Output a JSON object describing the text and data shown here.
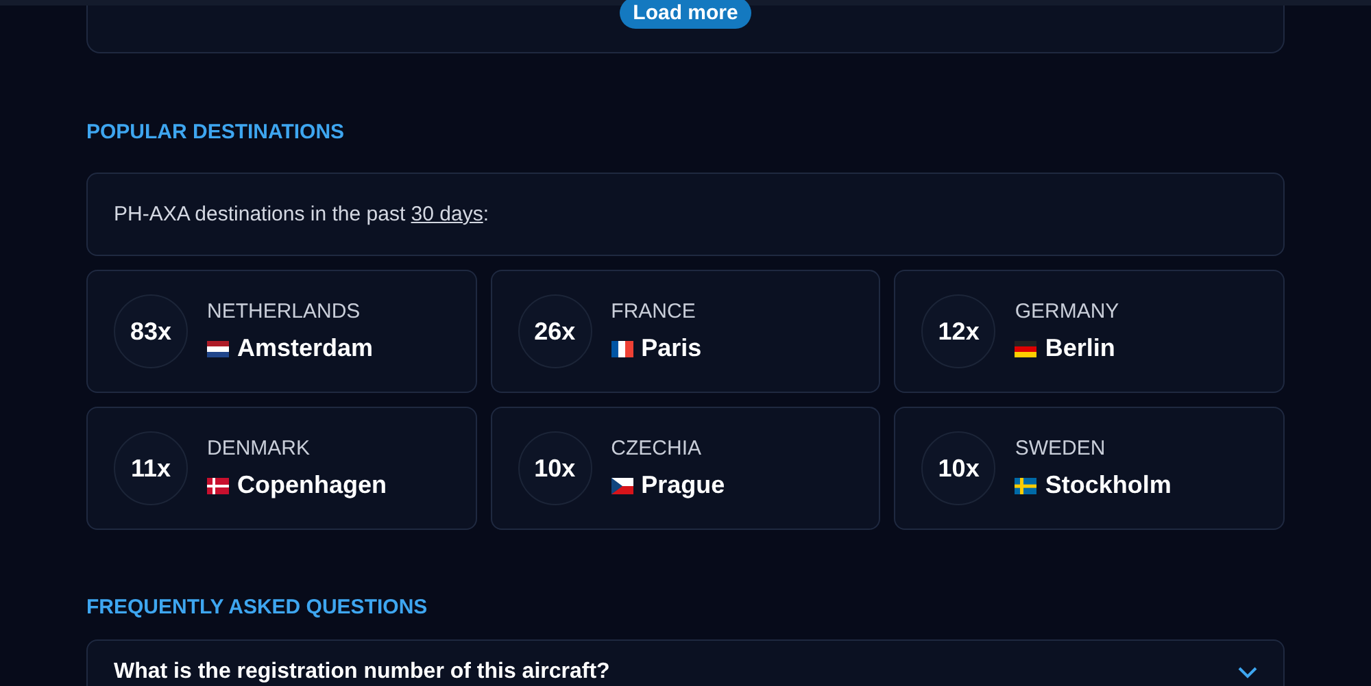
{
  "load_more": {
    "label": "Load more"
  },
  "popular": {
    "heading": "POPULAR DESTINATIONS",
    "intro": {
      "before": "PH-AXA destinations in the past ",
      "link": "30 days",
      "after": ":"
    },
    "destinations": [
      {
        "count": "83x",
        "country": "NETHERLANDS",
        "city": "Amsterdam",
        "kind": "nl"
      },
      {
        "count": "26x",
        "country": "FRANCE",
        "city": "Paris",
        "kind": "fr"
      },
      {
        "count": "12x",
        "country": "GERMANY",
        "city": "Berlin",
        "kind": "de"
      },
      {
        "count": "11x",
        "country": "DENMARK",
        "city": "Copenhagen",
        "kind": "dk"
      },
      {
        "count": "10x",
        "country": "CZECHIA",
        "city": "Prague",
        "kind": "cz"
      },
      {
        "count": "10x",
        "country": "SWEDEN",
        "city": "Stockholm",
        "kind": "se"
      }
    ]
  },
  "faq": {
    "heading": "FREQUENTLY ASKED QUESTIONS",
    "items": [
      {
        "question": "What is the registration number of this aircraft?",
        "expanded": false
      }
    ]
  }
}
